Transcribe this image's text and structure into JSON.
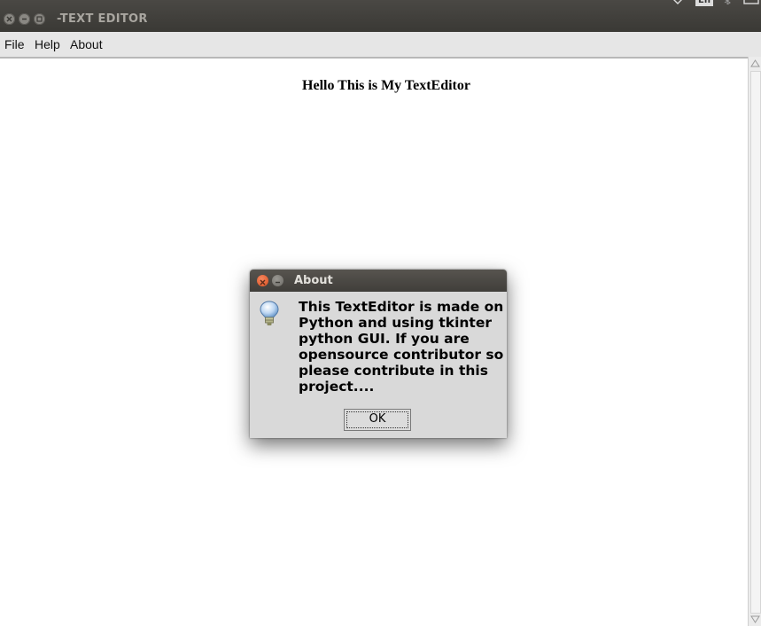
{
  "window": {
    "title": "-TEXT EDITOR"
  },
  "menu": {
    "items": [
      "File",
      "Help",
      "About"
    ]
  },
  "editor": {
    "content": "Hello This is My TextEditor"
  },
  "dialog": {
    "title": "About",
    "message": "This TextEditor is made on Python and using tkinter python GUI. If you are opensource contributor so please contribute in this project....",
    "ok_label": "OK",
    "icon": "lightbulb-info-icon"
  },
  "tray": {
    "keyboard": "En"
  },
  "colors": {
    "titlebar": "#3d3c38",
    "close_button": "#e2592a",
    "dialog_bg": "#d9d9d9",
    "menubar_bg": "#e6e6e6"
  }
}
